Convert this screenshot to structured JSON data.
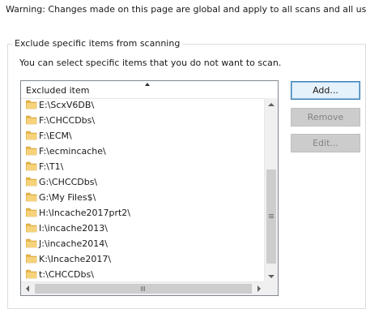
{
  "warning_text": "Warning: Changes made on this page are global and apply to all scans and all users.",
  "group": {
    "title": "Exclude specific items from scanning",
    "description": "You can select specific items that you do not want to scan."
  },
  "list": {
    "column_header": "Excluded item",
    "sort_direction": "ascending",
    "items": [
      "E:\\ScxV6DB\\",
      "F:\\CHCCDbs\\",
      "F:\\ECM\\",
      "F:\\ecmincache\\",
      "F:\\T1\\",
      "G:\\CHCCDbs\\",
      "G:\\My Files$\\",
      "H:\\Incache2017prt2\\",
      "I:\\incache2013\\",
      "J:\\incache2014\\",
      "K:\\Incache2017\\",
      "t:\\CHCCDbs\\"
    ]
  },
  "buttons": {
    "add": "Add...",
    "remove": "Remove",
    "edit": "Edit..."
  },
  "icons": {
    "item_icon": "folder-icon",
    "sort_icon": "sort-ascending-icon"
  },
  "colors": {
    "folder": "#e8b84a",
    "default_button_border": "#3c7fb1"
  }
}
